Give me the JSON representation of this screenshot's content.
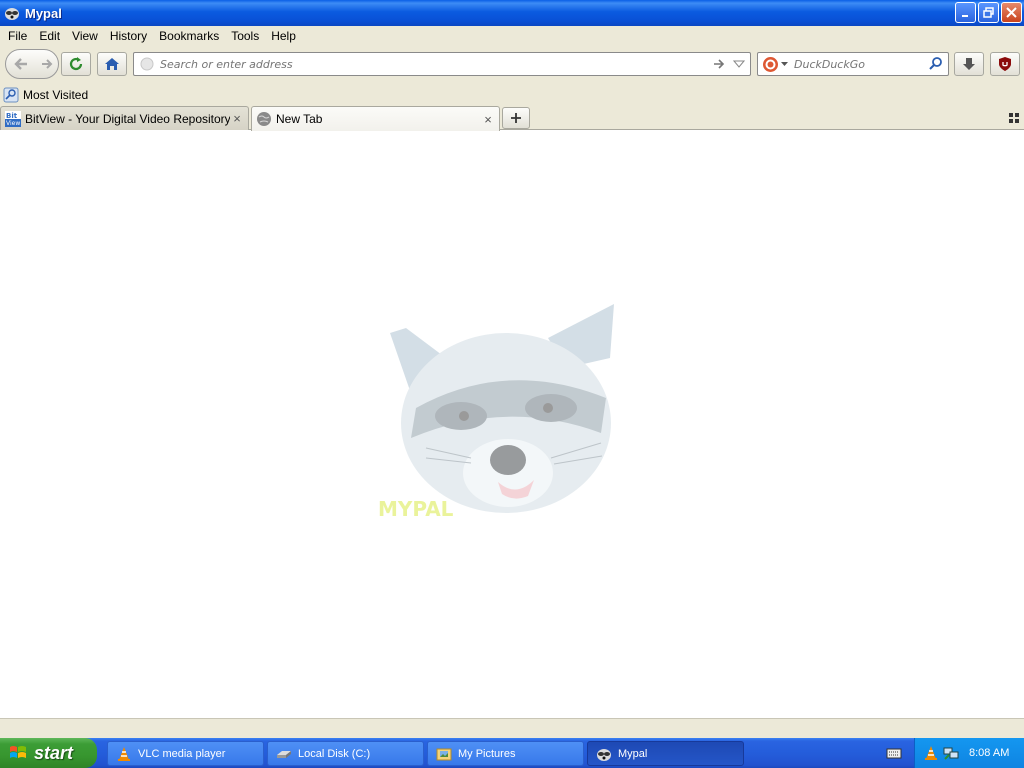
{
  "window": {
    "title": "Mypal"
  },
  "menu": [
    {
      "label": "File"
    },
    {
      "label": "Edit"
    },
    {
      "label": "View"
    },
    {
      "label": "History"
    },
    {
      "label": "Bookmarks"
    },
    {
      "label": "Tools"
    },
    {
      "label": "Help"
    }
  ],
  "navbar": {
    "url_placeholder": "Search or enter address",
    "search_placeholder": "DuckDuckGo"
  },
  "bookmarks": {
    "most_visited": "Most Visited"
  },
  "tabs": [
    {
      "label": "BitView - Your Digital Video Repository",
      "close": "×"
    },
    {
      "label": "New Tab",
      "close": "×"
    }
  ],
  "taskbar": {
    "start": "start",
    "tasks": [
      {
        "label": "VLC media player"
      },
      {
        "label": "Local Disk (C:)"
      },
      {
        "label": "My Pictures"
      },
      {
        "label": "Mypal"
      }
    ],
    "clock": "8:08 AM"
  },
  "colors": {
    "titlebar": "#0a5fe6",
    "taskbar": "#245ddb",
    "start": "#37962f",
    "tray": "#1497f0"
  }
}
